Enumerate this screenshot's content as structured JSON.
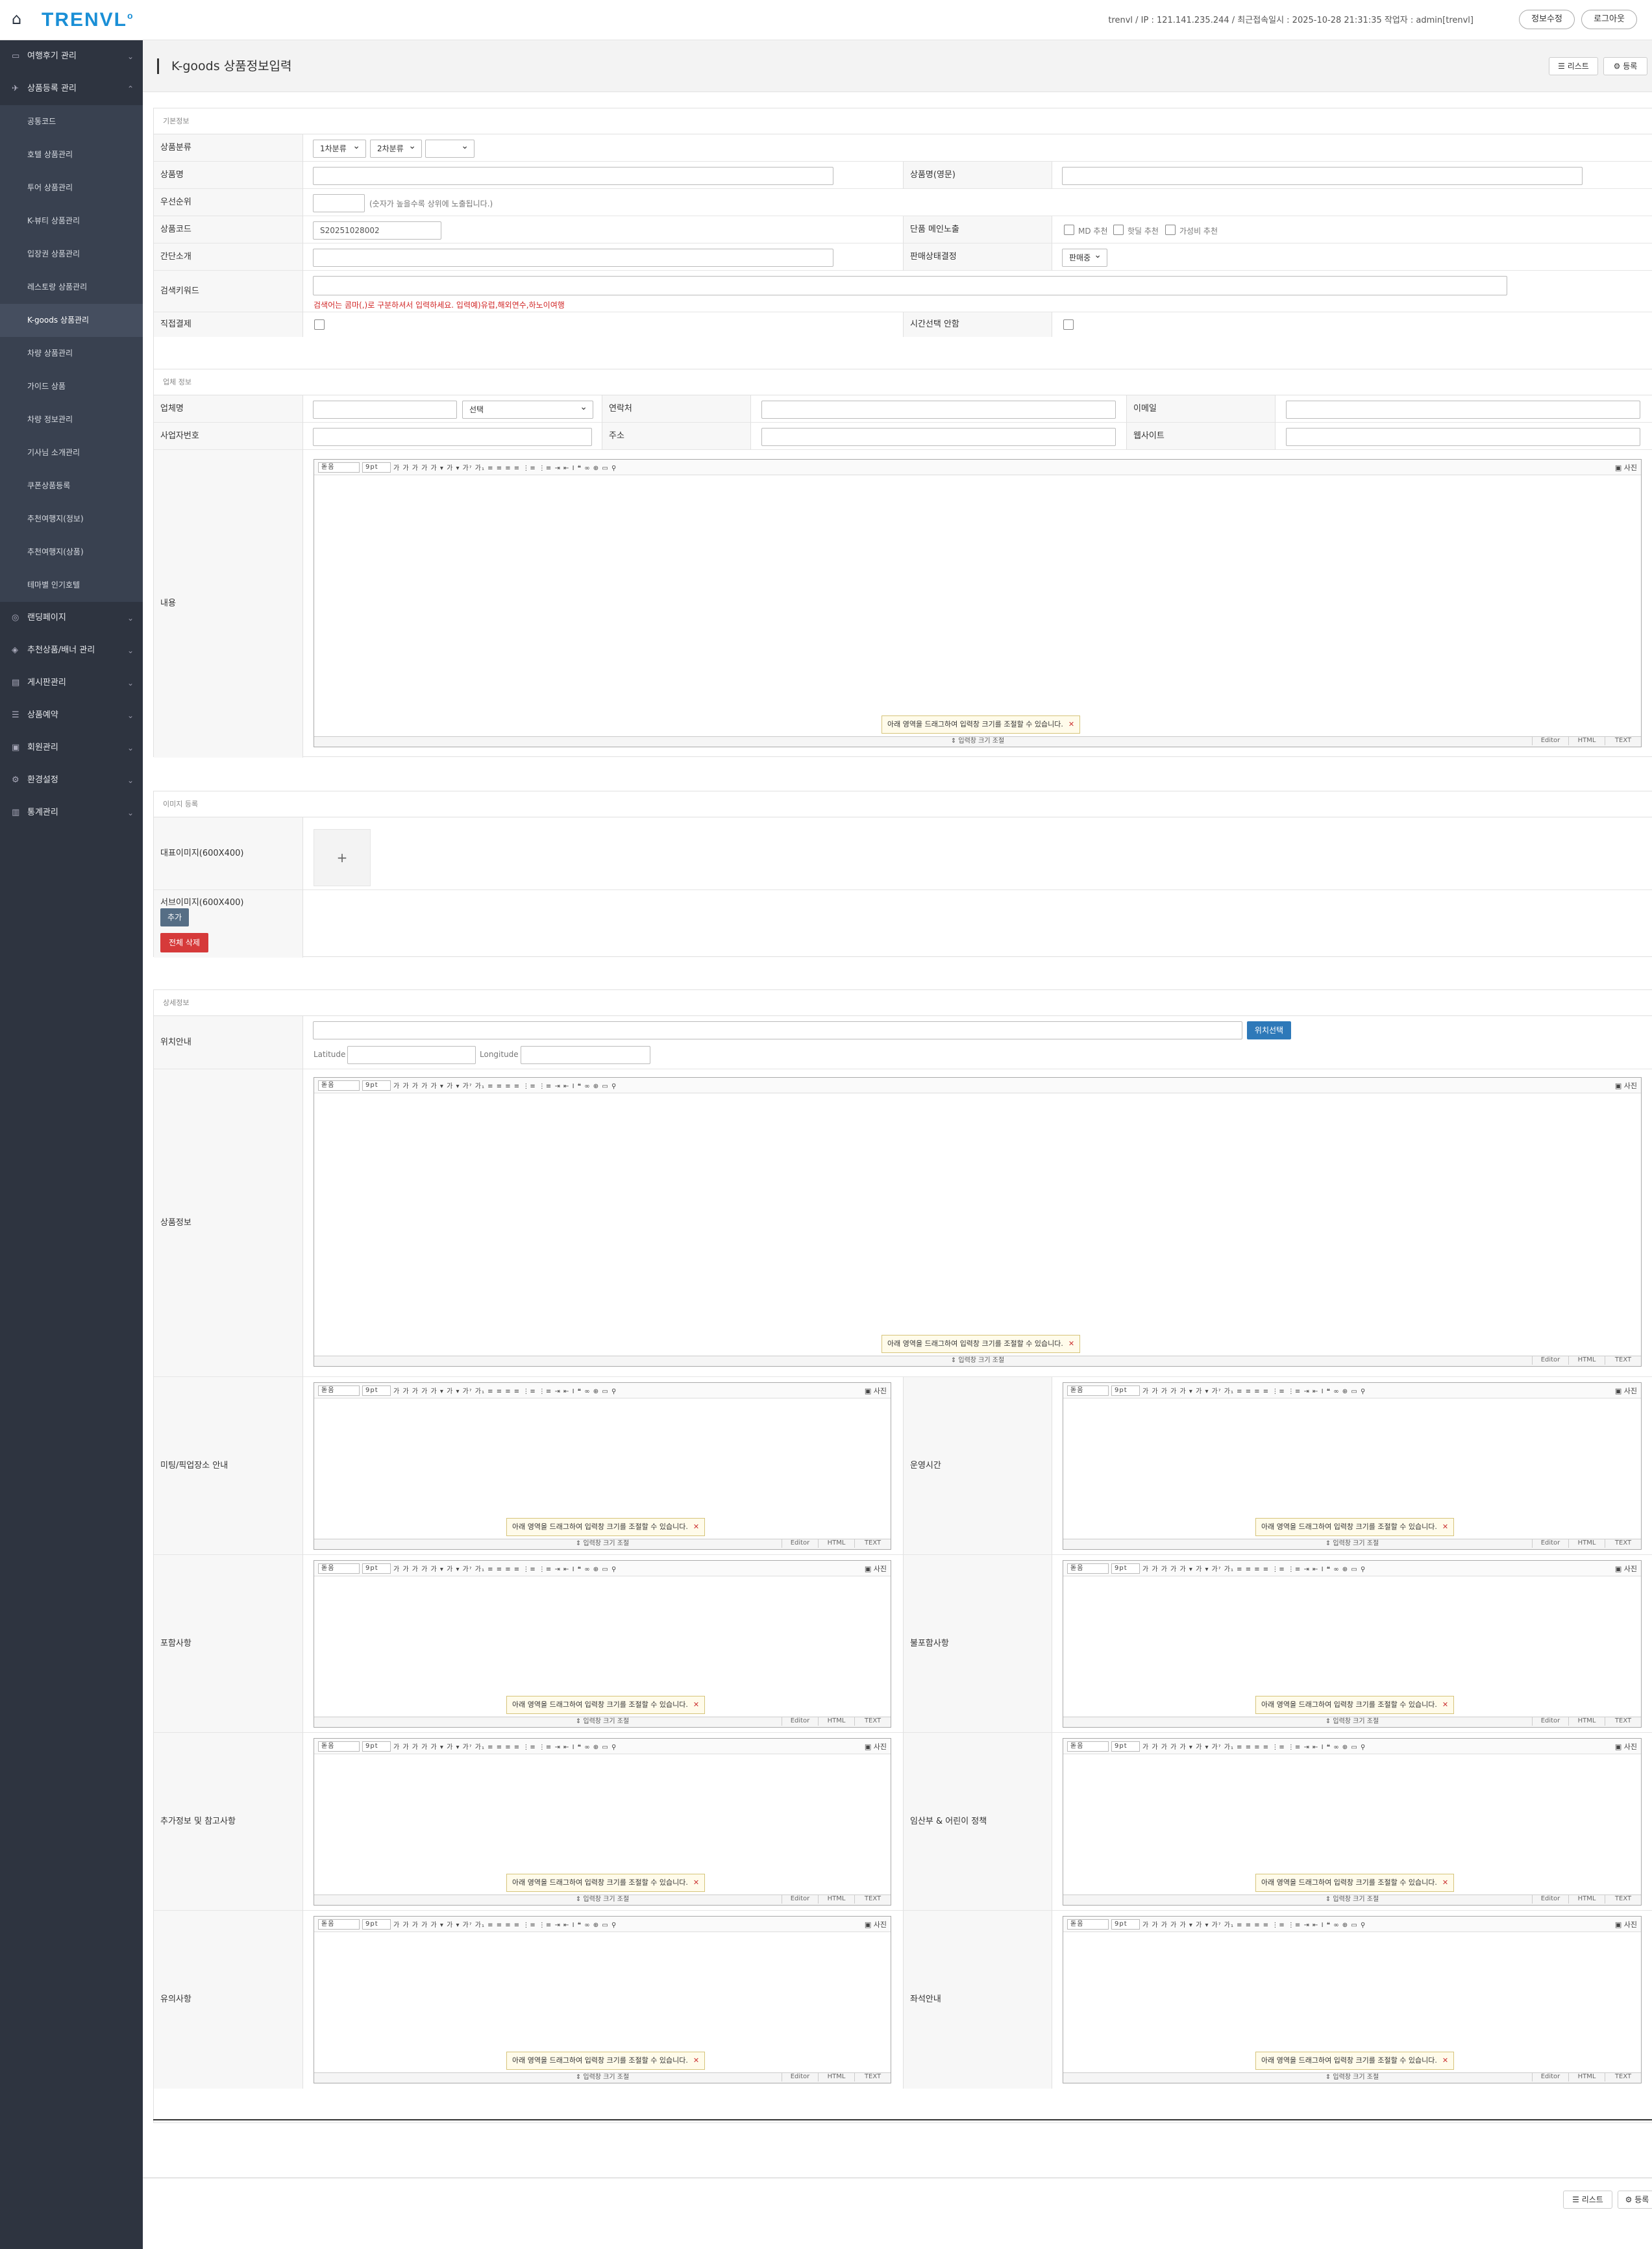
{
  "header": {
    "logo": "TRENVL",
    "info": "trenvl / IP : 121.141.235.244 / 최근접속일시 : 2025-10-28 21:31:35  작업자 : admin[trenvl]",
    "edit_info": "정보수정",
    "logout": "로그아웃"
  },
  "sidebar": {
    "items": [
      {
        "label": "여행후기 관리",
        "icon": "chat-icon"
      },
      {
        "label": "상품등록 관리",
        "icon": "plane-icon"
      },
      {
        "label": "랜딩페이지",
        "icon": "globe-icon"
      },
      {
        "label": "추천상품/배너 관리",
        "icon": "layers-icon"
      },
      {
        "label": "게시판관리",
        "icon": "board-icon"
      },
      {
        "label": "상품예약",
        "icon": "list-icon"
      },
      {
        "label": "회원관리",
        "icon": "member-icon"
      },
      {
        "label": "환경설정",
        "icon": "gear-icon"
      },
      {
        "label": "통계관리",
        "icon": "chart-icon"
      }
    ],
    "subitems": [
      "공통코드",
      "호텔 상품관리",
      "투어 상품관리",
      "K-뷰티 상품관리",
      "입장권 상품관리",
      "레스토랑 상품관리",
      "K-goods 상품관리",
      "차량 상품관리",
      "가이드 상품",
      "차량 정보관리",
      "기사님 소개관리",
      "쿠폰상품등록",
      "추천여행지(정보)",
      "추천여행지(상품)",
      "테마별 인기호텔"
    ],
    "active_sub": "K-goods 상품관리"
  },
  "page": {
    "title": "K-goods 상품정보입력",
    "list_button": "리스트",
    "register_button": "등록"
  },
  "basic": {
    "heading": "기본정보",
    "category_label": "상품분류",
    "cat1": "1차분류",
    "cat2": "2차분류",
    "cat3": "",
    "name_label": "상품명",
    "name_en_label": "상품명(영문)",
    "priority_label": "우선순위",
    "priority_note": "(숫자가 높을수록 상위에 노출됩니다.)",
    "code_label": "상품코드",
    "code_value": "S20251028002",
    "main_expose_label": "단품 메인노출",
    "chk_md": "MD 추천",
    "chk_hot": "핫딜 추천",
    "chk_value": "가성비 추천",
    "summary_label": "간단소개",
    "sale_status_label": "판매상태결정",
    "sale_status_value": "판매중",
    "keyword_label": "검색키워드",
    "keyword_note": "검색어는 콤마(,)로 구분하셔서 입력하세요. 입력예)유럽,해외연수,하노이여행",
    "direct_pay_label": "직접결제",
    "time_select_label": "시간선택 안함"
  },
  "company": {
    "heading": "업체 정보",
    "company_name_label": "업체명",
    "company_select": "선택",
    "contact_label": "연락처",
    "email_label": "이메일",
    "biz_no_label": "사업자번호",
    "address_label": "주소",
    "website_label": "웹사이트",
    "content_label": "내용"
  },
  "images": {
    "heading": "이미지 등록",
    "main_label": "대표이미지(600X400)",
    "sub_label": "서브이미지(600X400)",
    "add_button": "추가",
    "delete_all_button": "전체 삭제",
    "plus": "+"
  },
  "detail": {
    "heading": "상세정보",
    "location_label": "위치안내",
    "location_button": "위치선택",
    "latitude": "Latitude",
    "longitude": "Longitude",
    "product_info_label": "상품정보",
    "meeting_label": "미팅/픽업장소 안내",
    "hours_label": "운영시간",
    "included_label": "포함사항",
    "excluded_label": "불포함사항",
    "extra_label": "추가정보 및 참고사항",
    "policy_label": "임산부 & 어린이 정책",
    "caution_label": "유의사항",
    "seat_label": "좌석안내"
  },
  "editor": {
    "font": "돋움",
    "size": "9pt",
    "tools": "가 가 가 가 가 ▾ 가 ▾ 가ˀ 가₁ ≡ ≡ ≡ ≡ ⋮≡ ⋮≡ ⇥ ⇤ I  ❝  ∞ ⊕ ▭ ⚲",
    "photo": "사진",
    "resize": "⇕ 입력창 크기 조절",
    "mode_editor": "Editor",
    "mode_html": "HTML",
    "mode_text": "TEXT",
    "tip": "아래 영역을 드래그하여 입력창 크기를 조절할 수 있습니다.",
    "tip_close": "✕"
  },
  "footer": {
    "list_button": "리스트",
    "register_button": "등록"
  }
}
